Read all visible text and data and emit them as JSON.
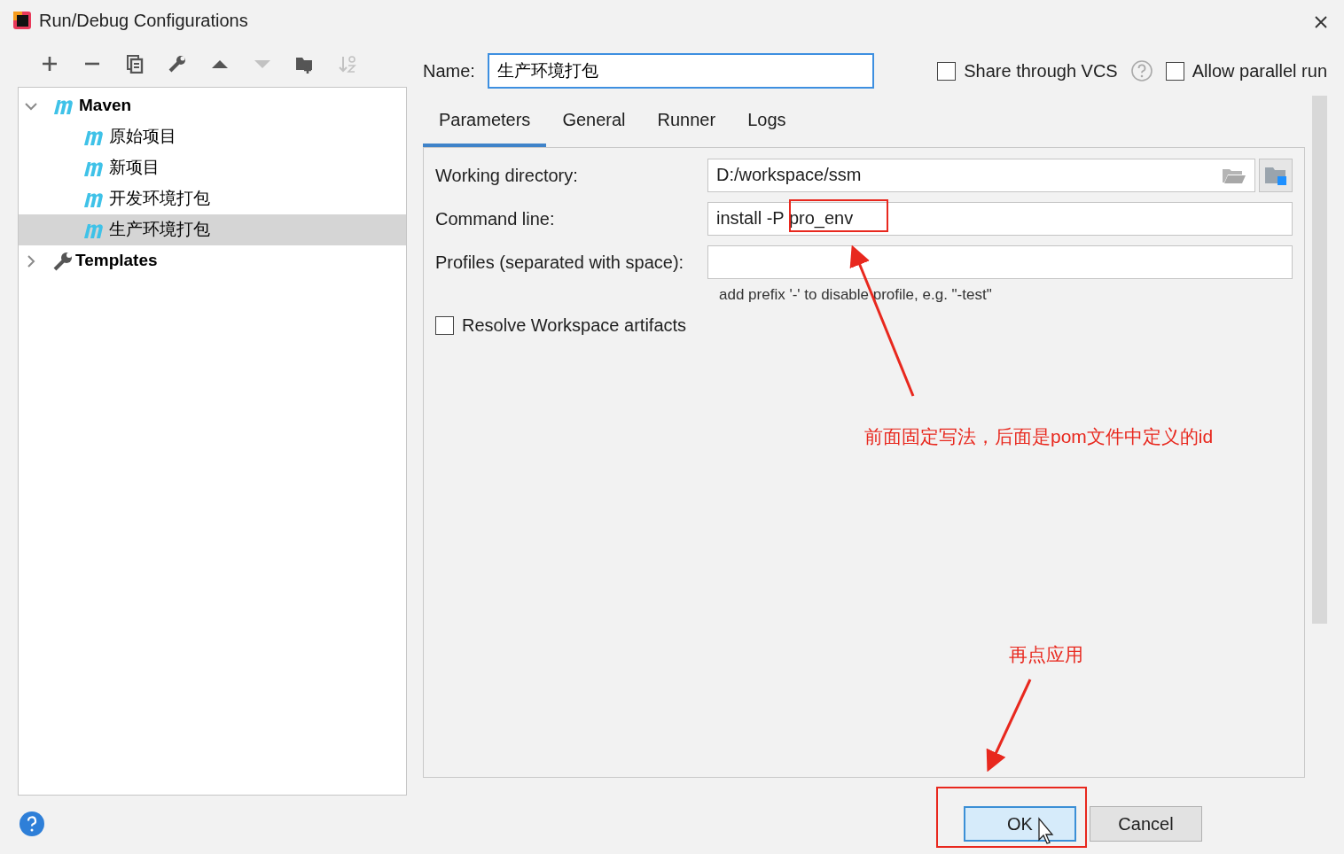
{
  "window": {
    "title": "Run/Debug Configurations"
  },
  "toolbar": [
    {
      "kind": "add",
      "disabled": false
    },
    {
      "kind": "remove",
      "disabled": false
    },
    {
      "kind": "copy",
      "disabled": false
    },
    {
      "kind": "edit",
      "disabled": false
    },
    {
      "kind": "up",
      "disabled": false
    },
    {
      "kind": "down",
      "disabled": true
    },
    {
      "kind": "folder",
      "disabled": false
    },
    {
      "kind": "sort",
      "disabled": true
    }
  ],
  "tree": [
    {
      "label": "Maven",
      "kind": "maven",
      "expanded": true,
      "selected": false,
      "children": [
        {
          "label": "原始项目",
          "kind": "maven",
          "selected": false
        },
        {
          "label": "新项目",
          "kind": "maven",
          "selected": false
        },
        {
          "label": "开发环境打包",
          "kind": "maven",
          "selected": false
        },
        {
          "label": "生产环境打包",
          "kind": "maven",
          "selected": true
        }
      ]
    },
    {
      "label": "Templates",
      "kind": "templates",
      "expanded": false,
      "selected": false
    }
  ],
  "name_field": {
    "label": "Name:",
    "value": "生产环境打包"
  },
  "options": [
    {
      "label": "Share through VCS",
      "checked": false
    },
    {
      "label": "Allow parallel run",
      "checked": false
    }
  ],
  "tabs": [
    {
      "label": "Parameters",
      "selected": true
    },
    {
      "label": "General",
      "selected": false
    },
    {
      "label": "Runner",
      "selected": false
    },
    {
      "label": "Logs",
      "selected": false
    }
  ],
  "form": [
    {
      "label": "Working directory:",
      "kind": "path",
      "value": "D:/workspace/ssm"
    },
    {
      "label": "Command line:",
      "kind": "text",
      "value": "install -P pro_env"
    },
    {
      "label": "Profiles (separated with space):",
      "kind": "text",
      "note": "add prefix '-' to disable profile, e.g. \"-test\""
    }
  ],
  "resolve_workspace": {
    "label": "Resolve Workspace artifacts",
    "checked": false
  },
  "buttons": [
    {
      "label": "OK",
      "kind": "default"
    },
    {
      "label": "Cancel",
      "kind": "normal"
    }
  ],
  "annotations": [
    {
      "text": "前面固定写法，后面是pom文件中定义的id"
    },
    {
      "text": "再点应用"
    }
  ]
}
